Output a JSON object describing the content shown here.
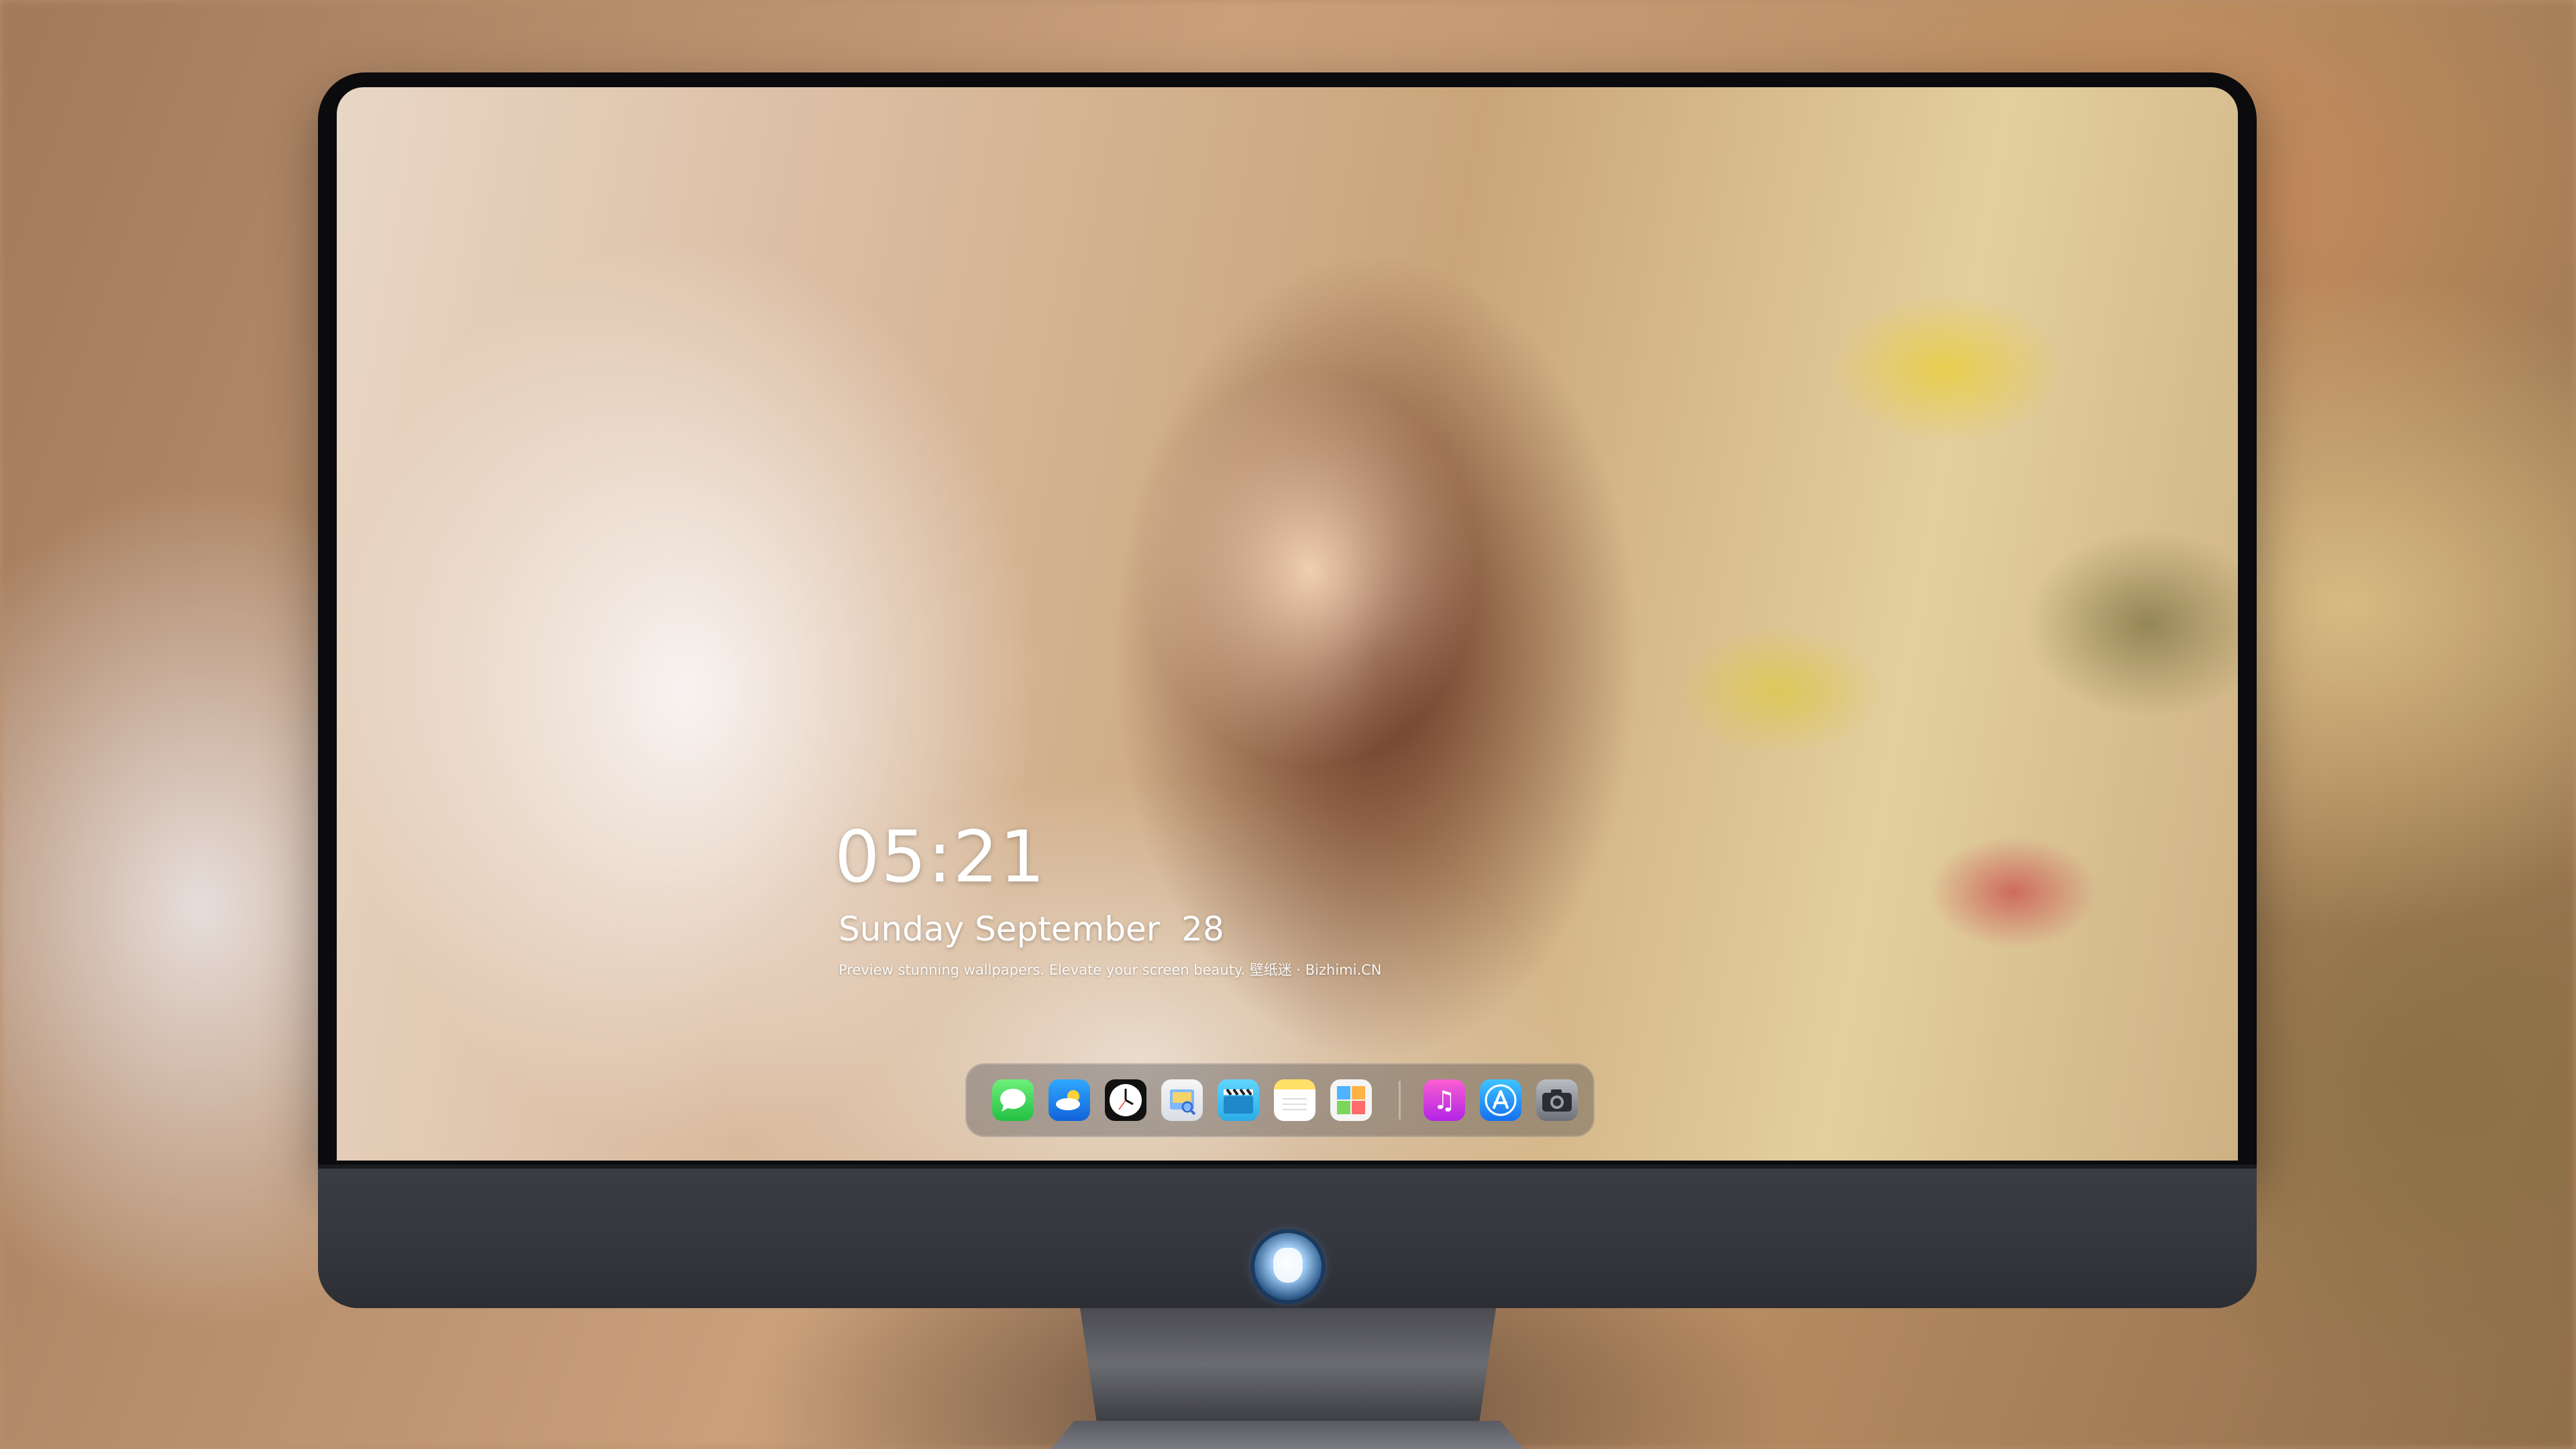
{
  "lock_screen": {
    "time": "05:21",
    "date": "Sunday September  28",
    "tagline": "Preview stunning wallpapers. Elevate your screen beauty. 壁纸迷 · Bizhimi.CN"
  },
  "dock": {
    "apps": [
      {
        "name": "Messages",
        "icon": "messages-icon"
      },
      {
        "name": "Weather",
        "icon": "weather-icon"
      },
      {
        "name": "Clock",
        "icon": "clock-icon"
      },
      {
        "name": "Preview",
        "icon": "preview-icon"
      },
      {
        "name": "Clips",
        "icon": "clapperboard-icon"
      },
      {
        "name": "Notes",
        "icon": "notes-icon"
      },
      {
        "name": "Photos",
        "icon": "photos-icon"
      },
      {
        "name": "Music",
        "icon": "music-icon"
      },
      {
        "name": "App Store",
        "icon": "app-store-icon"
      },
      {
        "name": "Camera",
        "icon": "camera-icon"
      }
    ]
  },
  "monitor": {
    "chin_logo": "mascot-logo"
  }
}
